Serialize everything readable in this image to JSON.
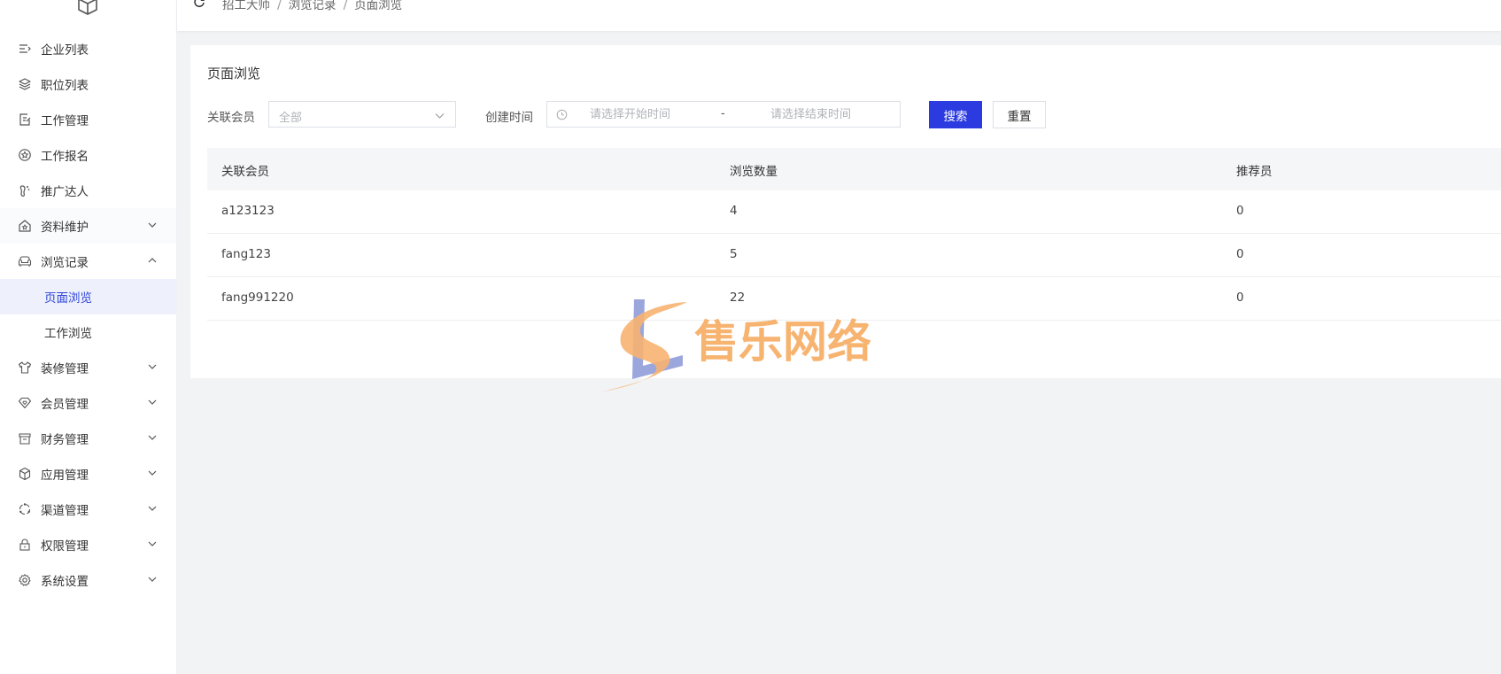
{
  "breadcrumbs": [
    "招工大师",
    "浏览记录",
    "页面浏览"
  ],
  "sidebar": {
    "items": [
      {
        "label": "企业列表",
        "icon": "list-icon"
      },
      {
        "label": "职位列表",
        "icon": "layers-icon"
      },
      {
        "label": "工作管理",
        "icon": "edit-document-icon"
      },
      {
        "label": "工作报名",
        "icon": "star-badge-icon"
      },
      {
        "label": "推广达人",
        "icon": "footprint-icon"
      },
      {
        "label": "资料维护",
        "icon": "home-star-icon"
      },
      {
        "label": "浏览记录",
        "icon": "sofa-icon"
      },
      {
        "label": "页面浏览"
      },
      {
        "label": "工作浏览"
      },
      {
        "label": "装修管理",
        "icon": "clothes-icon"
      },
      {
        "label": "会员管理",
        "icon": "diamond-heart-icon"
      },
      {
        "label": "财务管理",
        "icon": "wallet-icon"
      },
      {
        "label": "应用管理",
        "icon": "cube-icon"
      },
      {
        "label": "渠道管理",
        "icon": "cycle-icon"
      },
      {
        "label": "权限管理",
        "icon": "lock-icon"
      },
      {
        "label": "系统设置",
        "icon": "gear-icon"
      }
    ]
  },
  "page": {
    "title": "页面浏览",
    "filters": {
      "member_label": "关联会员",
      "member_value": "全部",
      "time_label": "创建时间",
      "start_placeholder": "请选择开始时间",
      "separator": "-",
      "end_placeholder": "请选择结束时间"
    },
    "buttons": {
      "search": "搜索",
      "reset": "重置"
    },
    "table": {
      "headers": [
        "关联会员",
        "浏览数量",
        "推荐员"
      ],
      "rows": [
        [
          "a123123",
          "4",
          "0"
        ],
        [
          "fang123",
          "5",
          "0"
        ],
        [
          "fang991220",
          "22",
          "0"
        ]
      ]
    }
  },
  "watermark": {
    "text": "售乐网络"
  },
  "colors": {
    "primary": "#2b3be0",
    "active_bg": "#eef1fb",
    "active_text": "#2f44d8",
    "watermark_orange": "#f7b370",
    "watermark_blue": "#8a96d6"
  }
}
